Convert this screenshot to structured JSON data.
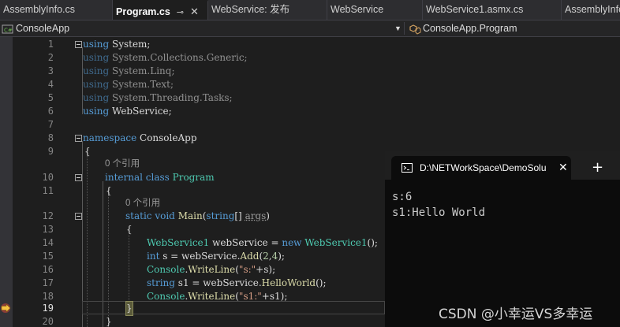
{
  "tabs": [
    {
      "label": "AssemblyInfo.cs"
    },
    {
      "label": "Program.cs",
      "pin": "⊸",
      "close": "✕"
    },
    {
      "label": "WebService: 发布"
    },
    {
      "label": "WebService"
    },
    {
      "label": "WebService1.asmx.cs"
    },
    {
      "label": "AssemblyInfo"
    }
  ],
  "navbar": {
    "project": "ConsoleApp",
    "scope": "ConsoleApp.Program"
  },
  "editor": {
    "line_numbers": [
      "1",
      "2",
      "3",
      "4",
      "5",
      "6",
      "7",
      "8",
      "9",
      "10",
      "11",
      "12",
      "13",
      "14",
      "15",
      "16",
      "17",
      "18",
      "19",
      "20"
    ],
    "usings": {
      "l1": {
        "kw": "using",
        "ns": "System;"
      },
      "l2": {
        "kw": "using",
        "ns": "System.Collections.Generic;"
      },
      "l3": {
        "kw": "using",
        "ns": "System.Linq;"
      },
      "l4": {
        "kw": "using",
        "ns": "System.Text;"
      },
      "l5": {
        "kw": "using",
        "ns": "System.Threading.Tasks;"
      },
      "l6": {
        "kw": "using",
        "ns": "WebService;"
      }
    },
    "l8": {
      "kw": "namespace",
      "name": "ConsoleApp"
    },
    "l9": "{",
    "codelens1": "0 个引用",
    "l10": {
      "kw1": "internal",
      "kw2": "class",
      "name": "Program"
    },
    "l11": "{",
    "codelens2": "0 个引用",
    "l12": {
      "kw1": "static",
      "kw2": "void",
      "fn": "Main",
      "p1": "(",
      "type": "string",
      "p2": "[] ",
      "param": "args",
      "p3": ")"
    },
    "l13": "{",
    "l14": {
      "type": "WebService1",
      "var": " webService = ",
      "kw": "new",
      "type2": " WebService1",
      "rest": "();"
    },
    "l15": {
      "kw": "int",
      "var": " s = webService.",
      "fn": "Add",
      "p1": "(",
      "n1": "2",
      "c": ",",
      "n2": "4",
      "rest": ");"
    },
    "l16": {
      "type": "Console",
      "dot": ".",
      "fn": "WriteLine",
      "p1": "(",
      "str": "\"s:\"",
      "rest": "+s);"
    },
    "l17": {
      "kw": "string",
      "var": " s1 = webService.",
      "fn": "HelloWorld",
      "rest": "();"
    },
    "l18": {
      "type": "Console",
      "dot": ".",
      "fn": "WriteLine",
      "p1": "(",
      "str": "\"s1:\"",
      "rest": "+s1);"
    },
    "l19": "}",
    "l20": "}"
  },
  "terminal": {
    "title": "D:\\NETWorkSpace\\DemoSolu",
    "close": "✕",
    "plus": "+",
    "output": [
      "s:6",
      "s1:Hello World"
    ]
  },
  "watermark": "CSDN @小幸运VS多幸运"
}
